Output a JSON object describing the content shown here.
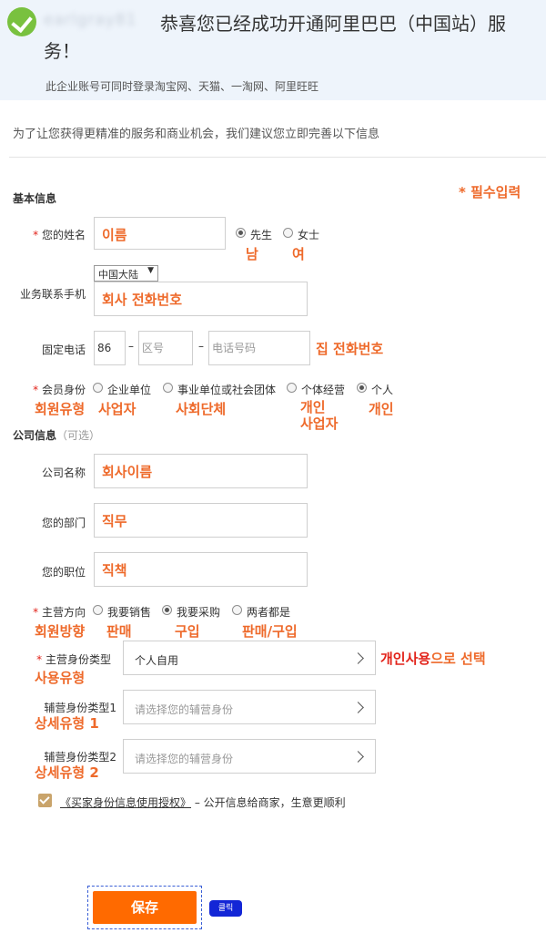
{
  "banner": {
    "username": "earlgray81",
    "title_line1": "恭喜您已经成功开通阿里巴巴（中国站）服",
    "title_line2": "务！",
    "subnote": "此企业账号可同时登录淘宝网、天猫、一淘网、阿里旺旺"
  },
  "intro": "为了让您获得更精准的服务和商业机会，我们建议您立即完善以下信息",
  "basic": {
    "title": "基本信息",
    "required_note": "* 필수입력",
    "name": {
      "label": "您的姓名",
      "annot": "이름"
    },
    "gender": [
      {
        "label": "先生",
        "annot": "남",
        "selected": true
      },
      {
        "label": "女士",
        "annot": "여",
        "selected": false
      }
    ],
    "mobile": {
      "label": "业务联系手机",
      "country": "中国大陆",
      "annot": "회사 전화번호"
    },
    "phone": {
      "label": "固定电话",
      "code": "86",
      "area_placeholder": "区号",
      "number_placeholder": "电话号码",
      "annot": "집 전화번호",
      "dash": "–"
    },
    "member": {
      "label": "会员身份",
      "label_annot": "회원유형",
      "options": [
        {
          "label": "企业单位",
          "annot": "사업자",
          "selected": false
        },
        {
          "label": "事业单位或社会团体",
          "annot": "사회단체",
          "selected": false
        },
        {
          "label": "个体经营",
          "annot": "개인\n사업자",
          "selected": false
        },
        {
          "label": "个人",
          "annot": "개인",
          "selected": true
        }
      ]
    }
  },
  "company": {
    "title": "公司信息",
    "note": "（可选）",
    "name": {
      "label": "公司名称",
      "annot": "회사이름"
    },
    "dept": {
      "label": "您的部门",
      "annot": "직무"
    },
    "position": {
      "label": "您的职位",
      "annot": "직책"
    },
    "direction": {
      "label": "主营方向",
      "label_annot": "회원방향",
      "options": [
        {
          "label": "我要销售",
          "annot": "판매",
          "selected": false
        },
        {
          "label": "我要采购",
          "annot": "구입",
          "selected": true
        },
        {
          "label": "两者都是",
          "annot": "판매/구입",
          "selected": false
        }
      ]
    },
    "main_type": {
      "label": "主营身份类型",
      "annot": "사용유형",
      "value": "个人自用",
      "hint_a": "개인사용",
      "hint_b": "으로 선택"
    },
    "sub1": {
      "label": "辅营身份类型1",
      "annot": "상세유형 1",
      "placeholder": "请选择您的辅营身份"
    },
    "sub2": {
      "label": "辅营身份类型2",
      "annot": "상세유형 2",
      "placeholder": "请选择您的辅营身份"
    }
  },
  "agreement": {
    "link": "《买家身份信息使用授权》",
    "text": " – 公开信息给商家，生意更顺利"
  },
  "save": {
    "label": "保存",
    "badge": "클릭"
  },
  "colors": {
    "accent": "#ff6a00",
    "annotation": "#ee6a2b",
    "required": "#e2231a",
    "banner": "#eef4fb",
    "check": "#79c13f"
  }
}
